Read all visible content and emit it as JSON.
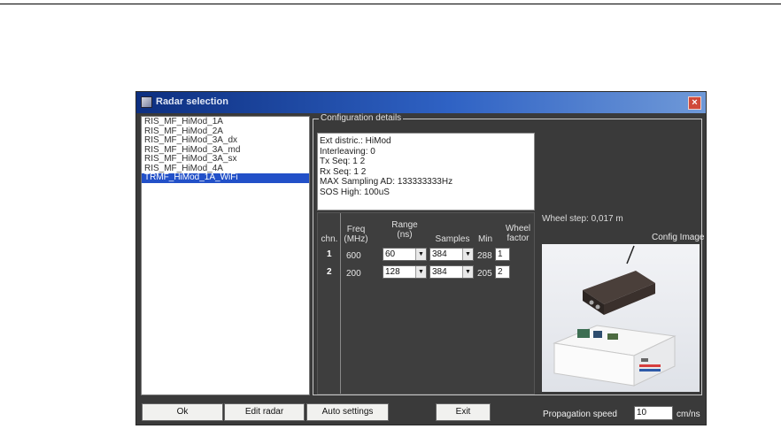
{
  "window": {
    "title": "Radar selection",
    "close_label": "×"
  },
  "radar_list": {
    "items": [
      {
        "label": "RIS_MF_HiMod_1A",
        "selected": false
      },
      {
        "label": "RIS_MF_HiMod_2A",
        "selected": false
      },
      {
        "label": "RIS_MF_HiMod_3A_dx",
        "selected": false
      },
      {
        "label": "RIS_MF_HiMod_3A_md",
        "selected": false
      },
      {
        "label": "RIS_MF_HiMod_3A_sx",
        "selected": false
      },
      {
        "label": "RIS_MF_HiMod_4A",
        "selected": false
      },
      {
        "label": "TRMF_HiMod_1A_WiFi",
        "selected": true
      }
    ]
  },
  "config": {
    "legend": "Configuration details",
    "details": [
      "Ext distric.: HiMod",
      "Interleaving: 0",
      "Tx Seq: 1 2",
      "Rx Seq: 1 2",
      "MAX Sampling AD: 133333333Hz",
      "SOS High: 100uS"
    ],
    "wheel_step": "Wheel step: 0,017 m",
    "config_image_label": "Config Image"
  },
  "channels": {
    "headers": {
      "chn": "chn.",
      "freq_line1": "Freq",
      "freq_line2": "(MHz)",
      "range_line1": "Range",
      "range_line2": "(ns)",
      "samples": "Samples",
      "min": "Min",
      "wheel_line1": "Wheel",
      "wheel_line2": "factor"
    },
    "rows": [
      {
        "chn": "1",
        "freq": "600",
        "range": "60",
        "samples": "384",
        "min": "288",
        "wheel_factor": "1"
      },
      {
        "chn": "2",
        "freq": "200",
        "range": "128",
        "samples": "384",
        "min": "205",
        "wheel_factor": "2"
      }
    ]
  },
  "buttons": {
    "ok": "Ok",
    "edit_radar": "Edit radar",
    "auto_settings": "Auto settings",
    "exit": "Exit"
  },
  "propagation": {
    "label": "Propagation speed",
    "value": "10",
    "unit": "cm/ns"
  },
  "colors": {
    "window_bg": "#3a3a3a",
    "titlebar": "#1d4aa8",
    "selection": "#2250c8"
  }
}
